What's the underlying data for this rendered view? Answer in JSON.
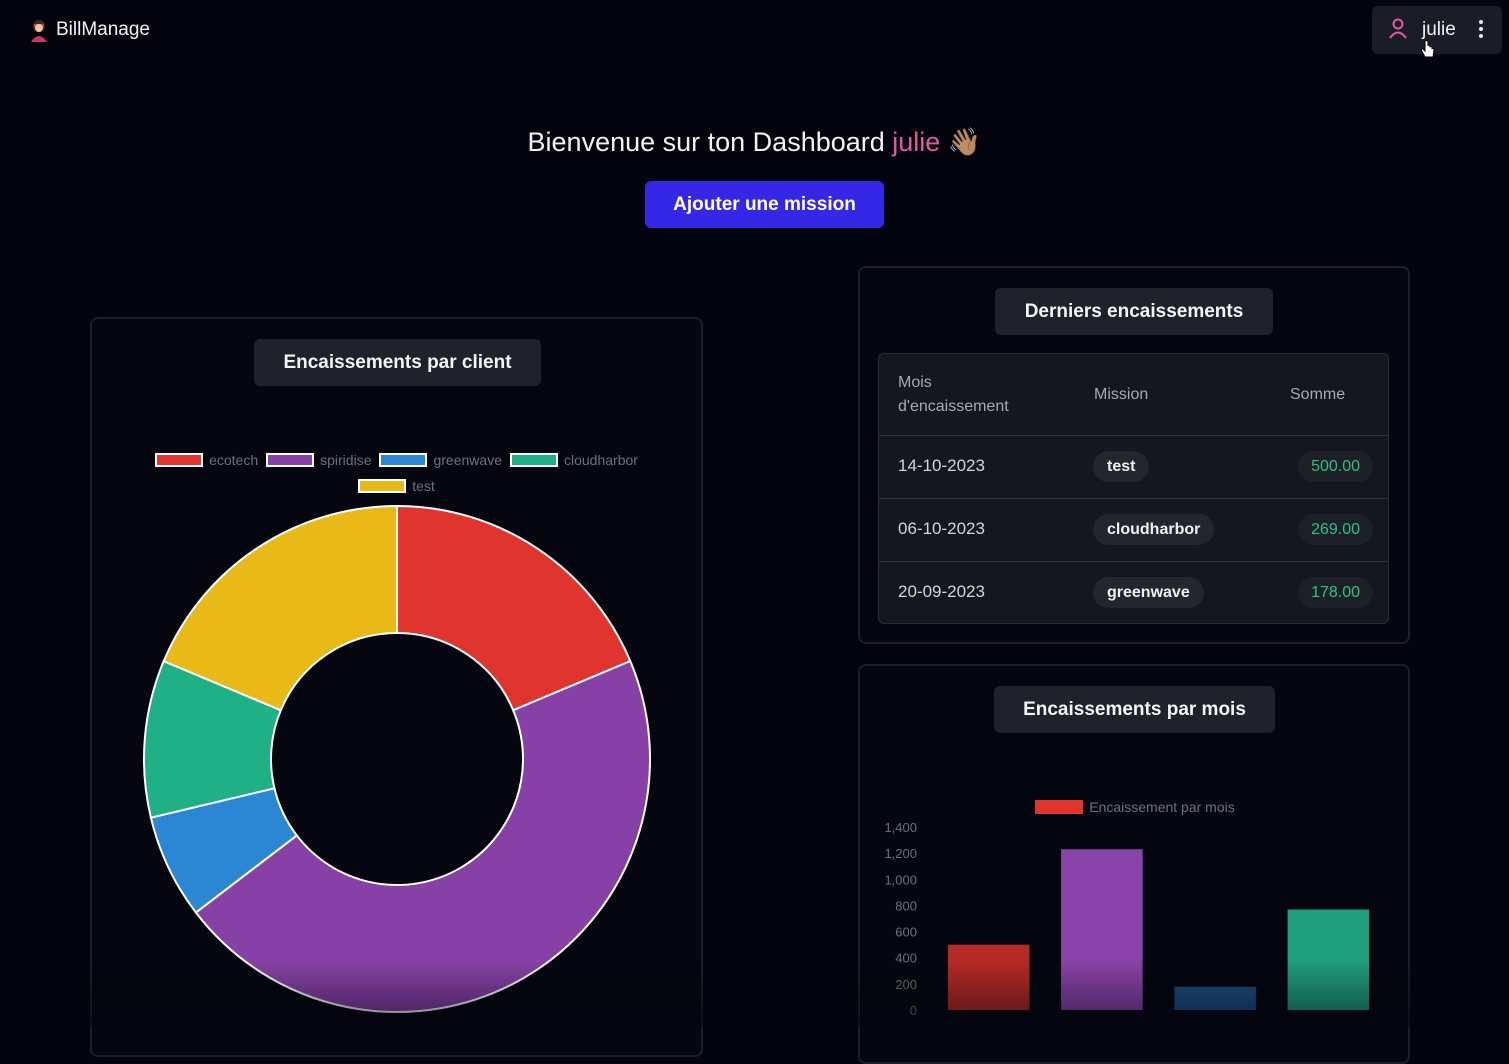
{
  "app": {
    "brand": "BillManage",
    "logo_icon": "avatar-icon"
  },
  "user_menu": {
    "name": "julie",
    "user_icon": "user-icon",
    "menu_icon": "kebab-icon"
  },
  "welcome": {
    "prefix": "Bienvenue sur ton Dashboard",
    "name": "julie",
    "emoji": "👋🏽"
  },
  "actions": {
    "add_mission": "Ajouter une mission"
  },
  "client_card": {
    "title": "Encaissements par client"
  },
  "payments_card": {
    "title": "Derniers encaissements",
    "columns": [
      "Mois d'encaissement",
      "Mission",
      "Somme"
    ],
    "rows": [
      {
        "date": "14-10-2023",
        "mission": "test",
        "amount": "500.00"
      },
      {
        "date": "06-10-2023",
        "mission": "cloudharbor",
        "amount": "269.00"
      },
      {
        "date": "20-09-2023",
        "mission": "greenwave",
        "amount": "178.00"
      }
    ]
  },
  "month_card": {
    "title": "Encaissements par mois"
  },
  "colors": {
    "accent": "#3527e6",
    "highlight": "#e05aa3",
    "positive": "#2ec27e"
  },
  "chart_data": [
    {
      "type": "pie",
      "variant": "doughnut",
      "labels": [
        "ecotech",
        "spiridise",
        "greenwave",
        "cloudharbor",
        "test"
      ],
      "values": [
        500,
        1230,
        178,
        269,
        500
      ],
      "colors": [
        "#e0352e",
        "#8741a6",
        "#2b86d4",
        "#1fb085",
        "#e9b918"
      ],
      "legend": "top"
    },
    {
      "type": "bar",
      "categories": [
        "",
        "",
        "",
        ""
      ],
      "series": [
        {
          "name": "Encaissement par mois",
          "values": [
            500,
            1230,
            178,
            769
          ]
        }
      ],
      "bar_colors": [
        "#b52a24",
        "#8a43a8",
        "#1c4d7c",
        "#1f9e7a"
      ],
      "ylim": [
        0,
        1400
      ],
      "yticks": [
        "0",
        "200",
        "400",
        "600",
        "800",
        "1,000",
        "1,200",
        "1,400"
      ],
      "legend": "top"
    }
  ]
}
